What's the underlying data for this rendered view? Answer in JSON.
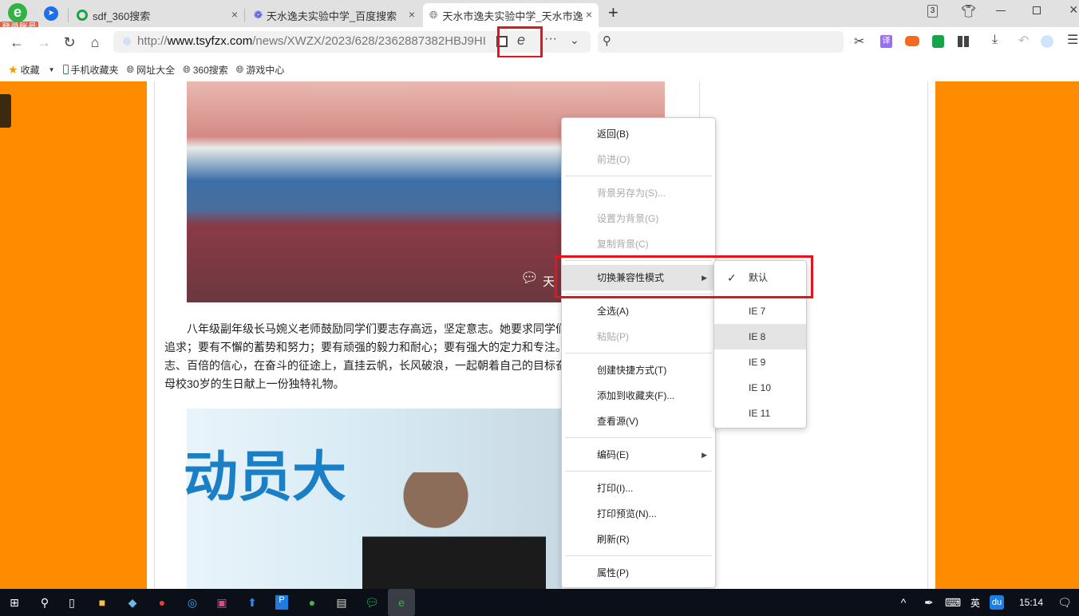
{
  "browser": {
    "login_badge": "登录账号",
    "tabs": [
      {
        "label": "sdf_360搜索"
      },
      {
        "label": "天水逸夫实验中学_百度搜索"
      },
      {
        "label": "天水市逸夫实验中学_天水市逸"
      }
    ],
    "tab_close": "×",
    "new_tab": "+",
    "tab_count": "3",
    "url_prefix": "http://",
    "url_domain": "www.tsyfzx.com",
    "url_path": "/news/XWZX/2023/628/2362887382HBJ9HI",
    "translate_label": "译"
  },
  "bookmarks": [
    {
      "label": "收藏",
      "icon": "star-icon"
    },
    {
      "label": "手机收藏夹",
      "icon": "phone-icon"
    },
    {
      "label": "网址大全",
      "icon": "globe-icon"
    },
    {
      "label": "360搜索",
      "icon": "globe-icon"
    },
    {
      "label": "游戏中心",
      "icon": "globe-icon"
    }
  ],
  "article": {
    "photo_caption": "天",
    "paragraph": [
      "　　八年级副年级长马婉义老师鼓励同学们要志存高远，坚定意志。她要求同学们",
      "追求；要有不懈的蓄势和努力；要有顽强的毅力和耐心；要有强大的定力和专注。",
      "志、百倍的信心，在奋斗的征途上，直挂云帆，长风破浪，一起朝着自己的目标奋",
      "母校30岁的生日献上一份独特礼物。"
    ],
    "photo2_text": "动员大"
  },
  "context_menu": {
    "items": [
      {
        "label": "返回(B)",
        "disabled": false
      },
      {
        "label": "前进(O)",
        "disabled": true
      },
      {
        "label": "背景另存为(S)...",
        "disabled": true
      },
      {
        "label": "设置为背景(G)",
        "disabled": true
      },
      {
        "label": "复制背景(C)",
        "disabled": true
      },
      {
        "label": "切换兼容性模式",
        "disabled": false
      },
      {
        "label": "全选(A)",
        "disabled": false
      },
      {
        "label": "粘贴(P)",
        "disabled": true
      },
      {
        "label": "创建快捷方式(T)",
        "disabled": false
      },
      {
        "label": "添加到收藏夹(F)...",
        "disabled": false
      },
      {
        "label": "查看源(V)",
        "disabled": false
      },
      {
        "label": "编码(E)",
        "disabled": false
      },
      {
        "label": "打印(I)...",
        "disabled": false
      },
      {
        "label": "打印预览(N)...",
        "disabled": false
      },
      {
        "label": "刷新(R)",
        "disabled": false
      },
      {
        "label": "属性(P)",
        "disabled": false
      }
    ],
    "submenu": [
      {
        "label": "默认",
        "checked": true
      },
      {
        "label": "IE 7"
      },
      {
        "label": "IE 8",
        "hovered": true
      },
      {
        "label": "IE 9"
      },
      {
        "label": "IE 10"
      },
      {
        "label": "IE 11"
      }
    ]
  },
  "taskbar": {
    "ime": "英",
    "baidu": "du",
    "time": "15:14"
  },
  "colors": {
    "page_bg": "#ff8c00",
    "highlight_box": "#e8121f"
  }
}
